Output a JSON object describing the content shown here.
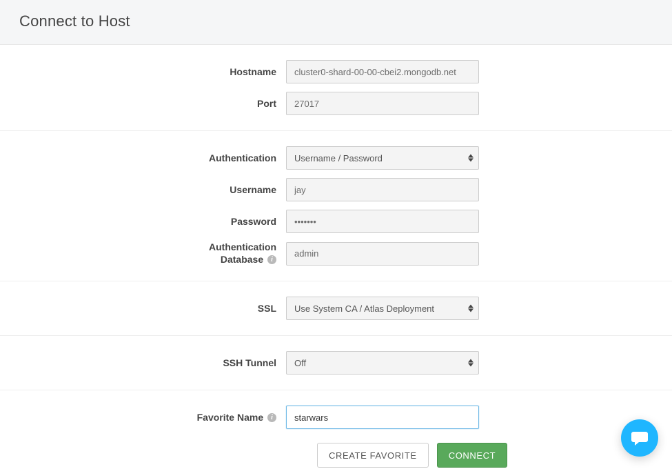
{
  "header": {
    "title": "Connect to Host"
  },
  "connection": {
    "hostname_label": "Hostname",
    "hostname_value": "cluster0-shard-00-00-cbei2.mongodb.net",
    "port_label": "Port",
    "port_value": "27017"
  },
  "auth": {
    "auth_label": "Authentication",
    "auth_selected": "Username / Password",
    "username_label": "Username",
    "username_value": "jay",
    "password_label": "Password",
    "password_value": "•••••••",
    "authdb_label_line1": "Authentication",
    "authdb_label_line2": "Database",
    "authdb_value": "admin"
  },
  "ssl": {
    "label": "SSL",
    "selected": "Use System CA / Atlas Deployment"
  },
  "ssh": {
    "label": "SSH Tunnel",
    "selected": "Off"
  },
  "favorite": {
    "label": "Favorite Name",
    "value": "starwars"
  },
  "buttons": {
    "create_favorite": "CREATE FAVORITE",
    "connect": "CONNECT"
  }
}
